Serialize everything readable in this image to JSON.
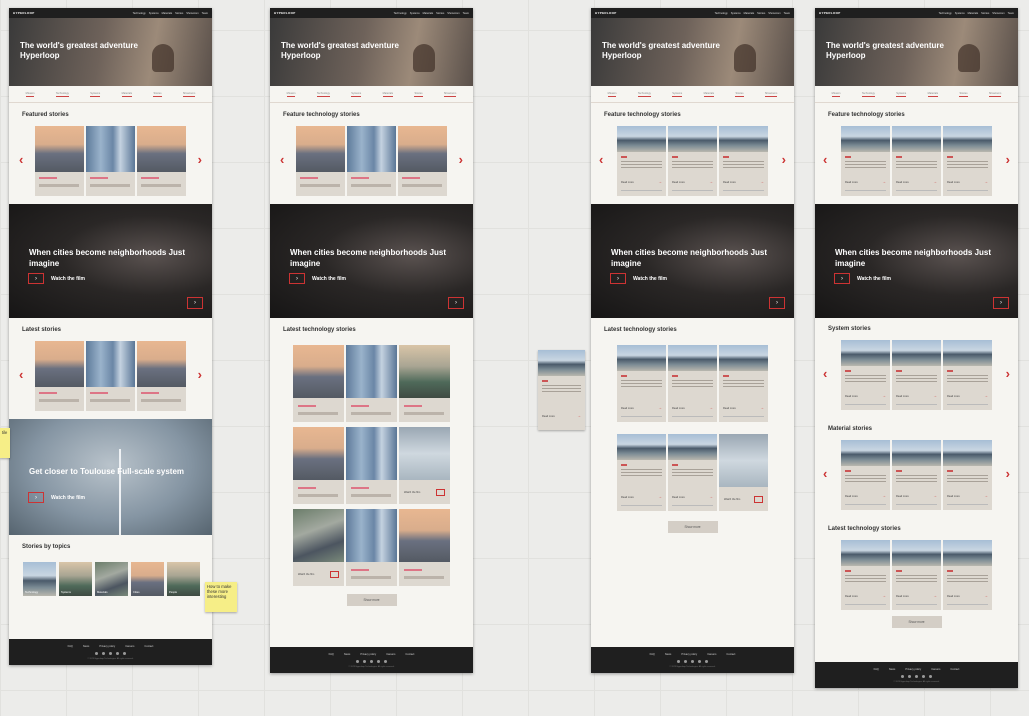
{
  "nav": {
    "logo": "HYPERLOOP",
    "links": [
      "Technology",
      "Systems",
      "Materials",
      "Stories",
      "Showroom",
      "Team"
    ]
  },
  "hero": {
    "title": "The world's greatest adventure Hyperloop"
  },
  "subnav": [
    "Mission",
    "Technology",
    "Systems",
    "Materials",
    "Stories",
    "Showroom"
  ],
  "boards": [
    {
      "sections": [
        "Featured stories",
        "Latest stories",
        "Stories by topics"
      ],
      "film": {
        "title": "When cities become neighborhoods Just imagine",
        "cta": "Watch the film"
      },
      "closer": {
        "title": "Get closer to Toulouse Full-scale system",
        "cta": "Watch the film"
      },
      "topics": [
        "Technology",
        "Systems",
        "Materials",
        "Cities",
        "People"
      ]
    },
    {
      "sections": [
        "Feature technology stories",
        "Latest technology stories"
      ],
      "show_more": "Show more"
    },
    {
      "sections": [
        "Feature technology stories",
        "Latest technology stories"
      ],
      "show_more": "Show more"
    },
    {
      "sections": [
        "Feature technology stories",
        "System stories",
        "Material stories",
        "Latest technology stories"
      ],
      "show_more": "Show more"
    }
  ],
  "card": {
    "read_more": "Read more",
    "watch": "Watch the film",
    "tag": "Title"
  },
  "footer": {
    "links": [
      "FAQ",
      "News",
      "Privacy policy",
      "Careers",
      "Contact"
    ],
    "copyright": "© 2023 Hyperloop Technologies. All rights reserved."
  },
  "sticky_note": "How to make these more interesting",
  "left_sticky": "tile"
}
